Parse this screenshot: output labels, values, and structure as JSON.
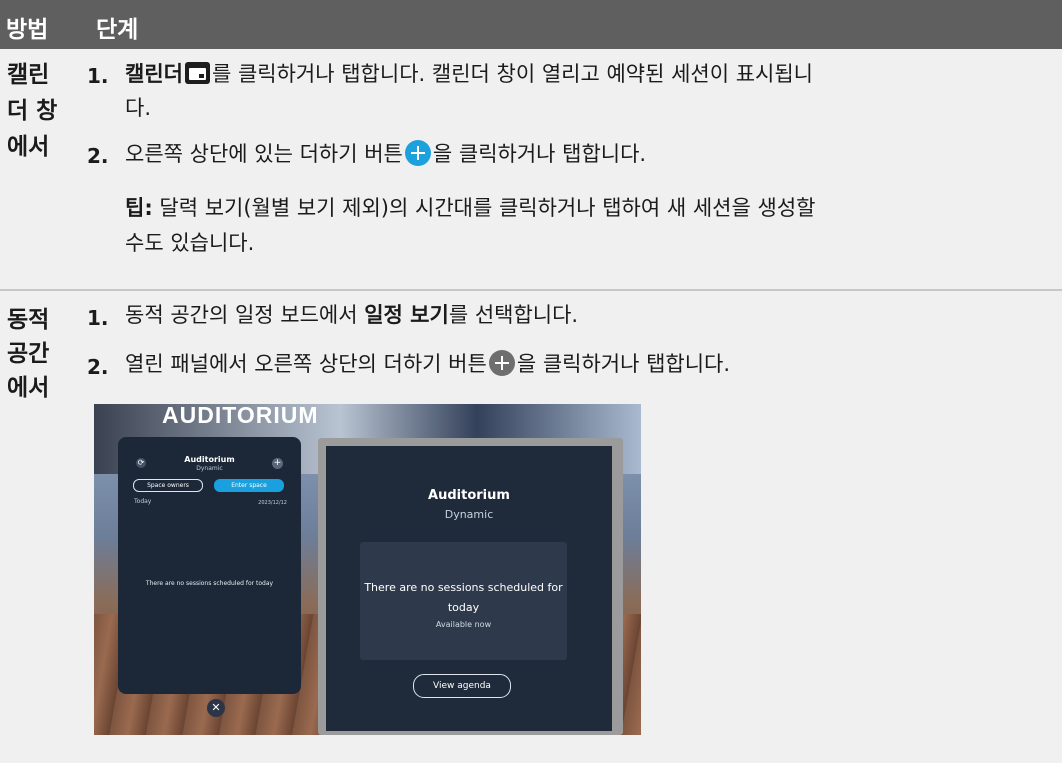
{
  "header": {
    "col_method": "방법",
    "col_steps": "단계"
  },
  "section1": {
    "method_lines": [
      "캘린",
      "더 창",
      "에서"
    ],
    "step1": {
      "number": "1.",
      "bold": "캘린더",
      "after_icon": "를 클릭하거나 탭합니다. 캘린더 창이 열리고 예약된 세션이 표시됩니",
      "wrap": "다.",
      "icon": "calendar-icon"
    },
    "step2": {
      "number": "2.",
      "before_icon": "오른쪽 상단에 있는 더하기 버튼",
      "after_icon": "을 클릭하거나 탭합니다.",
      "icon": "plus-icon"
    },
    "tip": {
      "label": "팁:",
      "line1": " 달력 보기(월별 보기 제외)의 시간대를 클릭하거나 탭하여 새 세션을 생성할",
      "line2": "수도 있습니다."
    }
  },
  "section2": {
    "method_lines": [
      "동적",
      "공간",
      "에서"
    ],
    "step1": {
      "number": "1.",
      "before": "동적 공간의 일정 보드에서 ",
      "bold": "일정 보기",
      "after": "를 선택합니다."
    },
    "step2": {
      "number": "2.",
      "before_icon": "열린 패널에서 오른쪽 상단의 더하기 버튼",
      "after_icon": "을 클릭하거나 탭합니다.",
      "icon": "plus-icon"
    }
  },
  "screenshot": {
    "sign": "AUDITORIUM",
    "left_panel": {
      "title": "Auditorium",
      "subtitle": "Dynamic",
      "refresh": "⟳",
      "plus": "+",
      "owners_button": "Space owners",
      "enter_button": "Enter space",
      "today": "Today",
      "date": "2023/12/12",
      "message": "There are no sessions scheduled for today",
      "close": "✕"
    },
    "right_panel": {
      "title": "Auditorium",
      "subtitle": "Dynamic",
      "message": "There are no sessions scheduled for today",
      "available": "Available now",
      "agenda_button": "View agenda"
    }
  }
}
